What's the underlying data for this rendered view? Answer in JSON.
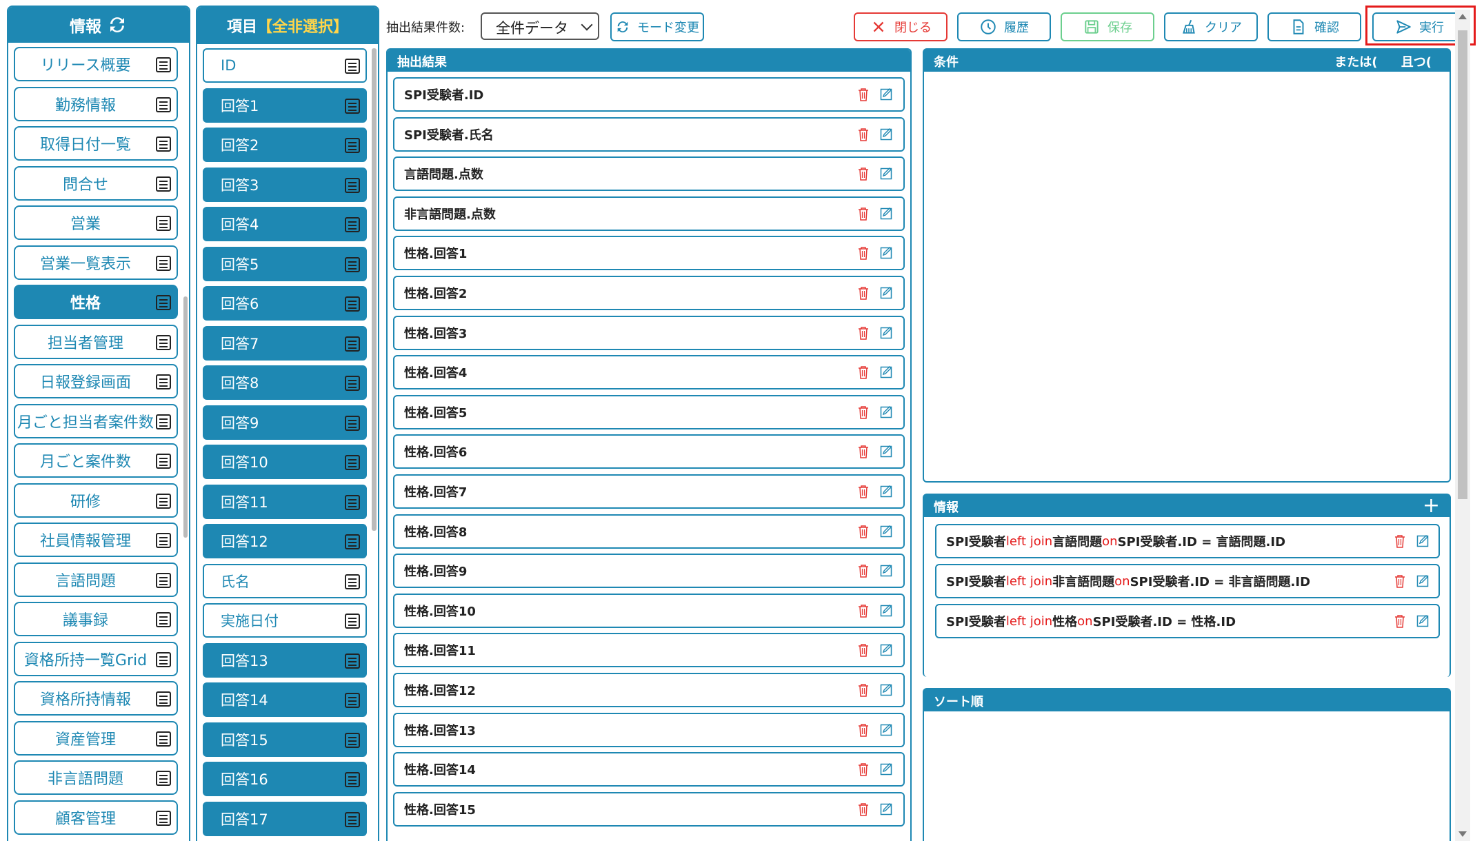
{
  "sidebar": {
    "title": "情報",
    "items": [
      {
        "label": "リリース概要",
        "active": false
      },
      {
        "label": "勤務情報",
        "active": false
      },
      {
        "label": "取得日付一覧",
        "active": false
      },
      {
        "label": "問合せ",
        "active": false
      },
      {
        "label": "営業",
        "active": false
      },
      {
        "label": "営業一覧表示",
        "active": false
      },
      {
        "label": "性格",
        "active": true
      },
      {
        "label": "担当者管理",
        "active": false
      },
      {
        "label": "日報登録画面",
        "active": false
      },
      {
        "label": "月ごと担当者案件数",
        "active": false
      },
      {
        "label": "月ごと案件数",
        "active": false
      },
      {
        "label": "研修",
        "active": false
      },
      {
        "label": "社員情報管理",
        "active": false
      },
      {
        "label": "言語問題",
        "active": false
      },
      {
        "label": "議事録",
        "active": false
      },
      {
        "label": "資格所持一覧Grid",
        "active": false
      },
      {
        "label": "資格所持情報",
        "active": false
      },
      {
        "label": "資産管理",
        "active": false
      },
      {
        "label": "非言語問題",
        "active": false
      },
      {
        "label": "顧客管理",
        "active": false
      }
    ]
  },
  "fields": {
    "title_prefix": "項目",
    "title_highlight": "【全非選択】",
    "items": [
      {
        "label": "ID",
        "selected": false
      },
      {
        "label": "回答1",
        "selected": true
      },
      {
        "label": "回答2",
        "selected": true
      },
      {
        "label": "回答3",
        "selected": true
      },
      {
        "label": "回答4",
        "selected": true
      },
      {
        "label": "回答5",
        "selected": true
      },
      {
        "label": "回答6",
        "selected": true
      },
      {
        "label": "回答7",
        "selected": true
      },
      {
        "label": "回答8",
        "selected": true
      },
      {
        "label": "回答9",
        "selected": true
      },
      {
        "label": "回答10",
        "selected": true
      },
      {
        "label": "回答11",
        "selected": true
      },
      {
        "label": "回答12",
        "selected": true
      },
      {
        "label": "氏名",
        "selected": false
      },
      {
        "label": "実施日付",
        "selected": false
      },
      {
        "label": "回答13",
        "selected": true
      },
      {
        "label": "回答14",
        "selected": true
      },
      {
        "label": "回答15",
        "selected": true
      },
      {
        "label": "回答16",
        "selected": true
      },
      {
        "label": "回答17",
        "selected": true
      }
    ]
  },
  "toolbar": {
    "count_label": "抽出結果件数:",
    "count_select_value": "全件データ",
    "mode_button": "モード変更",
    "close_button": "閉じる",
    "history_button": "履歴",
    "save_button": "保存",
    "clear_button": "クリア",
    "confirm_button": "確認",
    "execute_button": "実行"
  },
  "results": {
    "title": "抽出結果",
    "rows": [
      "SPI受験者.ID",
      "SPI受験者.氏名",
      "言語問題.点数",
      "非言語問題.点数",
      "性格.回答1",
      "性格.回答2",
      "性格.回答3",
      "性格.回答4",
      "性格.回答5",
      "性格.回答6",
      "性格.回答7",
      "性格.回答8",
      "性格.回答9",
      "性格.回答10",
      "性格.回答11",
      "性格.回答12",
      "性格.回答13",
      "性格.回答14",
      "性格.回答15"
    ]
  },
  "conditions": {
    "title": "条件",
    "or_label": "または(",
    "and_label": "且つ("
  },
  "info": {
    "title": "情報",
    "add_symbol": "+",
    "joins": [
      {
        "left": "SPI受験者",
        "join_kw": "left join",
        "table": "言語問題",
        "on_kw": "on",
        "cond": "SPI受験者.ID = 言語問題.ID"
      },
      {
        "left": "SPI受験者",
        "join_kw": "left join",
        "table": "非言語問題",
        "on_kw": "on",
        "cond": "SPI受験者.ID = 非言語問題.ID"
      },
      {
        "left": "SPI受験者",
        "join_kw": "left join",
        "table": "性格",
        "on_kw": "on",
        "cond": "SPI受験者.ID = 性格.ID"
      }
    ]
  },
  "sort": {
    "title": "ソート順"
  },
  "colors": {
    "primary": "#1e88b3",
    "danger": "#e53935",
    "success": "#6ccf8e",
    "highlight": "#ffd54a",
    "keyword": "#e41b1b"
  }
}
